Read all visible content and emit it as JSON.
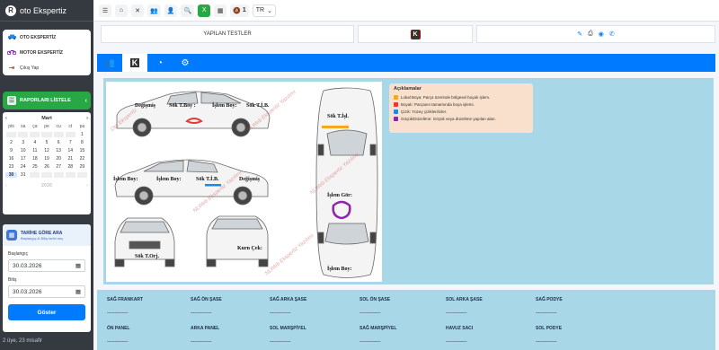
{
  "brand": {
    "name": "oto Ekspertiz",
    "logo_letter": "R"
  },
  "sidebar": {
    "menu": [
      {
        "label": "OTO EKSPERTİZ",
        "icon": "car-icon",
        "color": "#1e88e5"
      },
      {
        "label": "MOTOR EKSPERTİZ",
        "icon": "motorcycle-icon",
        "color": "#7b1fa2"
      },
      {
        "label": "Çıkış Yap",
        "icon": "logout-icon",
        "color": "#c62828"
      }
    ],
    "reports_label": "RAPORLARI LİSTELE",
    "calendar": {
      "month": "Mart",
      "year": "2026",
      "weekdays": [
        "pts",
        "sa",
        "ça",
        "pe",
        "cu",
        "ct",
        "pa"
      ],
      "weeks": [
        [
          "",
          "",
          "",
          "",
          "",
          "",
          "1"
        ],
        [
          "2",
          "3",
          "4",
          "5",
          "6",
          "7",
          "8"
        ],
        [
          "9",
          "10",
          "11",
          "12",
          "13",
          "14",
          "15"
        ],
        [
          "16",
          "17",
          "18",
          "19",
          "20",
          "21",
          "22"
        ],
        [
          "23",
          "24",
          "25",
          "26",
          "27",
          "28",
          "29"
        ],
        [
          "30",
          "31",
          "",
          "",
          "",
          "",
          ""
        ]
      ],
      "today": "30"
    },
    "date_search": {
      "title": "TARİHE GÖRE ARA",
      "subtitle": "Başlangıç & Bitiş tarihi seç",
      "start_label": "Başlangıç",
      "start_value": "30.03.2026",
      "end_label": "Bitiş",
      "end_value": "30.03.2026",
      "button_label": "Göster"
    },
    "footer": "2 üye, 23 misafir"
  },
  "topbar": {
    "notification_count": "1",
    "language": "TR"
  },
  "title_row": {
    "label": "YAPILAN TESTLER",
    "k_label": "K"
  },
  "tabs": [
    {
      "name": "tab-users",
      "icon": "👥"
    },
    {
      "name": "tab-k",
      "icon": "K"
    },
    {
      "name": "tab-speedometer",
      "icon": "◔"
    },
    {
      "name": "tab-settings",
      "icon": "⚙"
    }
  ],
  "diagram": {
    "notes": [
      "Değişmiş",
      "Sök T.Boy :",
      "İşlem Boy:",
      "Sök T.İ.B.",
      "İşlem Boy:",
      "İşlem Boy:",
      "Sök T.İ.B.",
      "Değişmiş",
      "Sök T.İşl.",
      "İşlem Gör:",
      "İşlem Boy:",
      "Sök T.Orj.",
      "Kurn Çek:"
    ],
    "watermark": "NLWeb Ekspertiz Yazılımı",
    "watermark_short": "Oto Ekspertiz"
  },
  "legend": {
    "title": "Açıklamalar",
    "items": [
      {
        "text": "Lokal Boya: Parça üzerinde bölgesel boyalı işlem.",
        "color": "#f5a623"
      },
      {
        "text": "Boyalı: Parçanın tamamında boya işlemi.",
        "color": "#e53935"
      },
      {
        "text": "Çizik: Yüzey çizikleri/izler.",
        "color": "#1e88e5"
      },
      {
        "text": "Göçük/Düzeltme: Göçük veya düzeltme yapılan alan.",
        "color": "#8e24aa"
      }
    ]
  },
  "table": {
    "row1": [
      {
        "header": "SAĞ FRANKART",
        "value": "-----------------"
      },
      {
        "header": "SAĞ ÖN ŞASE",
        "value": "-----------------"
      },
      {
        "header": "SAĞ ARKA ŞASE",
        "value": "-----------------"
      },
      {
        "header": "SOL ÖN ŞASE",
        "value": "-----------------"
      },
      {
        "header": "SOL ARKA ŞASE",
        "value": "-----------------"
      },
      {
        "header": "SAĞ PODYE",
        "value": "-----------------"
      }
    ],
    "row2": [
      {
        "header": "ÖN PANEL",
        "value": "-----------------"
      },
      {
        "header": "ARKA PANEL",
        "value": "-----------------"
      },
      {
        "header": "SOL MARŞPİYEL",
        "value": "-----------------"
      },
      {
        "header": "SAĞ MARŞPİYEL",
        "value": "-----------------"
      },
      {
        "header": "HAVUZ SACI",
        "value": "-----------------"
      },
      {
        "header": "SOL PODYE",
        "value": "-----------------"
      }
    ]
  }
}
